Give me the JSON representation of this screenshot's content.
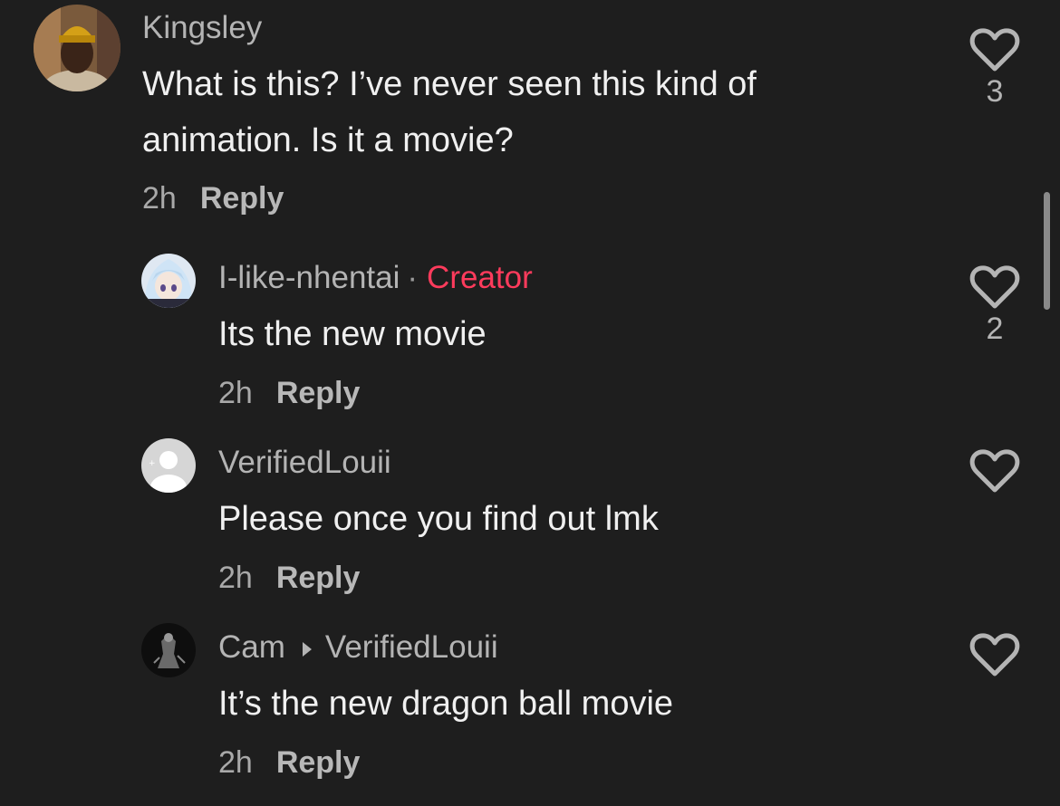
{
  "comments": [
    {
      "username": "Kingsley",
      "text_line1": "What is this? I’ve never seen this kind of",
      "text_line2": "animation. Is it a movie?",
      "time": "2h",
      "reply_label": "Reply",
      "like_count": "3",
      "avatar": "person-yellow-beanie"
    },
    {
      "username": "I-like-nhentai",
      "separator": "·",
      "badge": "Creator",
      "text": "Its the new movie",
      "time": "2h",
      "reply_label": "Reply",
      "like_count": "2",
      "avatar": "anime-character"
    },
    {
      "username": "VerifiedLouii",
      "text": "Please once you find out lmk",
      "time": "2h",
      "reply_label": "Reply",
      "like_count": "",
      "avatar": "default-avatar"
    },
    {
      "username": "Cam",
      "reply_to": "VerifiedLouii",
      "text": "It’s the new dragon ball movie",
      "time": "2h",
      "reply_label": "Reply",
      "like_count": "",
      "avatar": "dark-figure"
    }
  ],
  "colors": {
    "background": "#1e1e1e",
    "creator_badge": "#ff3b5c",
    "username": "#b4b4b4",
    "text": "#f0f0f0"
  },
  "icons": [
    "heart-outline-icon",
    "caret-right-icon"
  ]
}
